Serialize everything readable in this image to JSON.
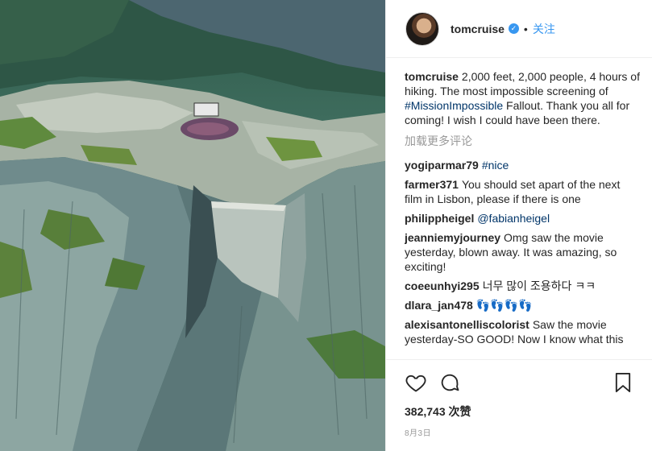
{
  "header": {
    "username": "tomcruise",
    "verified_mark": "✓",
    "separator": "•",
    "follow_label": "关注"
  },
  "caption": {
    "username": "tomcruise",
    "text_before": "2,000 feet, 2,000 people, 4 hours of hiking. The most impossible screening of ",
    "hashtag": "#MissionImpossible",
    "text_after": " Fallout. Thank you all for coming! I wish I could have been there."
  },
  "load_more_label": "加载更多评论",
  "comments": [
    {
      "username": "yogiparmar79",
      "text": "",
      "tag": "#nice"
    },
    {
      "username": "farmer371",
      "text": "You should set apart of the next film in Lisbon, please if there is one",
      "tag": ""
    },
    {
      "username": "philippheigel",
      "text": "",
      "tag": "@fabianheigel"
    },
    {
      "username": "jeanniemyjourney",
      "text": "Omg saw the movie yesterday, blown away. It was amazing, so exciting!",
      "tag": ""
    },
    {
      "username": "coeeunhyi295",
      "text": "너무 많이 조용하다 ㅋㅋ",
      "tag": ""
    },
    {
      "username": "dlara_jan478",
      "text": "👣👣👣👣",
      "tag": ""
    },
    {
      "username": "alexisantonelliscolorist",
      "text": "Saw the movie yesterday-SO GOOD! Now I know what this",
      "tag": ""
    }
  ],
  "likes": "382,743 次赞",
  "date": "8月3日",
  "icons": {
    "like": "heart-icon",
    "comment": "comment-bubble-icon",
    "save": "bookmark-icon"
  }
}
